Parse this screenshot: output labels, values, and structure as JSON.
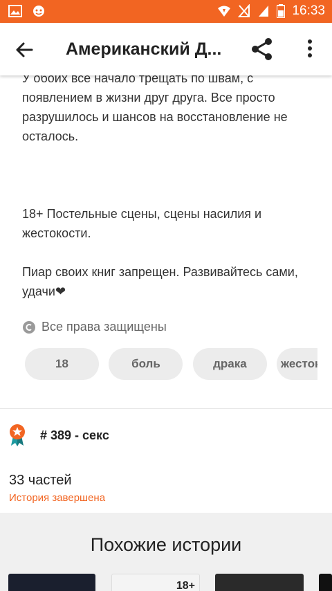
{
  "status_bar": {
    "time": "16:33",
    "colors": {
      "background": "#f26522"
    }
  },
  "app_bar": {
    "title": "Американский Д...",
    "icons": [
      "back-arrow-icon",
      "share-icon",
      "more-vertical-icon"
    ]
  },
  "description": {
    "paragraph_1": "У обоих все начало трещать по швам, с появлением в жизни друг друга. Все просто разрушилось и шансов на восстановление не осталось.",
    "paragraph_2": "18+ Постельные сцены, сцены насилия и жестокости.",
    "paragraph_3": "Пиар своих книг запрещен. Развивайтесь сами, удачи❤"
  },
  "rights": {
    "icon": "copyright-icon",
    "text": "Все права защищены"
  },
  "tags": [
    "18",
    "боль",
    "драка",
    "жестокость"
  ],
  "ranking": {
    "icon": "rank-badge-icon",
    "text": "# 389 - секс"
  },
  "parts": {
    "count": "33 частей",
    "status": "История завершена",
    "status_color": "#f26522"
  },
  "similar": {
    "title": "Похожие истории",
    "cover_2_badge": "18+"
  }
}
